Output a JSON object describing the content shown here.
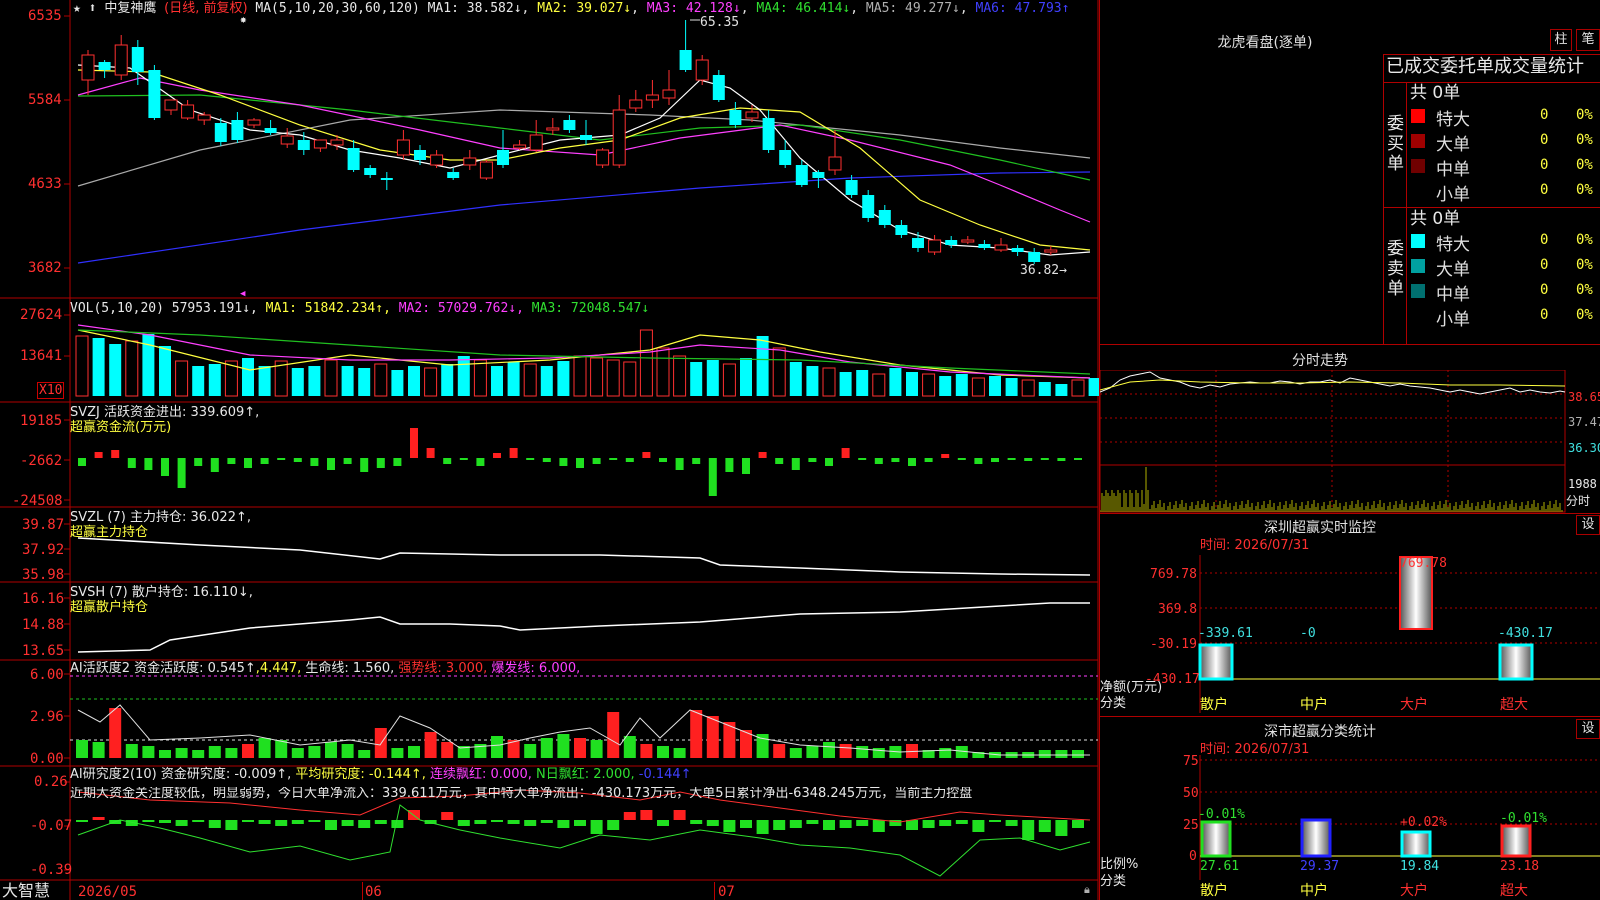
{
  "main": {
    "stock": "中复神鹰",
    "period": "(日线, 前复权)",
    "ma_params": "MA(5,10,20,30,60,120)",
    "ma_values": [
      "MA1: 38.582↓",
      "MA2: 39.027↓",
      "MA3: 42.128↓",
      "MA4: 46.414↓",
      "MA5: 49.277↓",
      "MA6: 47.793↑"
    ],
    "y_labels": [
      "6535",
      "5584",
      "4633",
      "3682"
    ],
    "high_mark": "65.35",
    "low_mark": "36.82",
    "low_arrow": "→"
  },
  "vol": {
    "title": "VOL(5,10,20)",
    "value": "57953.191↓,",
    "mas": [
      "MA1: 51842.234↑,",
      "MA2: 57029.762↓,",
      "MA3: 72048.547↓"
    ],
    "y_labels": [
      "27624",
      "13641"
    ],
    "unit": "X10"
  },
  "svzj": {
    "title": "SVZJ  活跃资金进出: 339.609↑,",
    "subtitle": "超赢资金流(万元)",
    "y_labels": [
      "19185",
      "-2662",
      "-24508"
    ]
  },
  "svzl": {
    "title": "SVZL (7) 主力持仓: 36.022↑,",
    "subtitle": "超赢主力持仓",
    "y_labels": [
      "39.87",
      "37.92",
      "35.98"
    ]
  },
  "svsh": {
    "title": "SVSH (7) 散户持仓: 16.110↓,",
    "subtitle": "超赢散户持仓",
    "y_labels": [
      "16.16",
      "14.88",
      "13.65"
    ]
  },
  "ai1": {
    "name": "AI活跃度2",
    "t1": "资金活跃度: 0.545↑",
    "t2": ",4.447,",
    "t3": "生命线: 1.560,",
    "t4": "强势线: 3.000,",
    "t5": "爆发线: 6.000,",
    "y_labels": [
      "6.00",
      "2.96",
      "0.00"
    ]
  },
  "ai2": {
    "name": "AI研究度2(10)",
    "t1": "资金研究度: -0.009↑,",
    "t2": "平均研究度: -0.144↑,",
    "t3": "连续飘红: 0.000,",
    "t4": "N日飘红: 2.000,",
    "t5": "-0.144↑",
    "comment": "近期大资金关注度较低，明显弱势，今日大单净流入：339.611万元，其中特大单净流出：-430.173万元，大单5日累计净出-6348.245万元，当前主力控盘",
    "y_labels": [
      "0.26",
      "-0.07",
      "-0.39"
    ]
  },
  "bottom": {
    "brand": "大智慧",
    "dates": [
      "2026/05",
      "06",
      "07"
    ]
  },
  "longhu": {
    "title": "龙虎看盘(逐单)",
    "btn1": "柱",
    "btn2": "笔",
    "header": "已成交委托单成交量统计",
    "buy_label": "委买单",
    "sell_label": "委卖单",
    "buy_total": "共 0单",
    "sell_total": "共 0单",
    "buy_rows": [
      {
        "name": "特大",
        "count": "0",
        "pct": "0%",
        "color": "#ff0000"
      },
      {
        "name": "大单",
        "count": "0",
        "pct": "0%",
        "color": "#a00000"
      },
      {
        "name": "中单",
        "count": "0",
        "pct": "0%",
        "color": "#700000"
      },
      {
        "name": "小单",
        "count": "0",
        "pct": "0%",
        "color": ""
      }
    ],
    "sell_rows": [
      {
        "name": "特大",
        "count": "0",
        "pct": "0%",
        "color": "#00ffff"
      },
      {
        "name": "大单",
        "count": "0",
        "pct": "0%",
        "color": "#00a0a0"
      },
      {
        "name": "中单",
        "count": "0",
        "pct": "0%",
        "color": "#007070"
      },
      {
        "name": "小单",
        "count": "0",
        "pct": "0%",
        "color": ""
      }
    ]
  },
  "fenshi": {
    "title": "分时走势",
    "y_labels": [
      "38.65",
      "37.47",
      "36.30"
    ],
    "vol_label": "1988",
    "vol_unit": "分时"
  },
  "sz_monitor": {
    "title": "深圳超赢实时监控",
    "btn": "设",
    "time": "时间: 2026/07/31",
    "y_labels": [
      "769.78",
      "369.8",
      "-30.19",
      "-430.17"
    ],
    "bar_labels": [
      "-339.61",
      "-0",
      "769.78",
      "-430.17"
    ],
    "y_axis_name": "净额(万元)",
    "x_axis_name": "分类",
    "categories": [
      "散户",
      "中户",
      "大户",
      "超大"
    ]
  },
  "sz_class": {
    "title": "深市超赢分类统计",
    "btn": "设",
    "time": "时间: 2026/07/31",
    "y_labels": [
      "75",
      "50",
      "25",
      "0"
    ],
    "top_labels": [
      "-0.01%",
      "",
      "+0.02%",
      "-0.01%"
    ],
    "bottom_labels": [
      "27.61",
      "29.37",
      "19.84",
      "23.18"
    ],
    "y_axis_name": "比例%",
    "x_axis_name": "分类",
    "categories": [
      "散户",
      "中户",
      "大户",
      "超大"
    ]
  },
  "colors": {
    "up": "#ff3030",
    "down": "#00ffff",
    "border": "#b00000"
  }
}
